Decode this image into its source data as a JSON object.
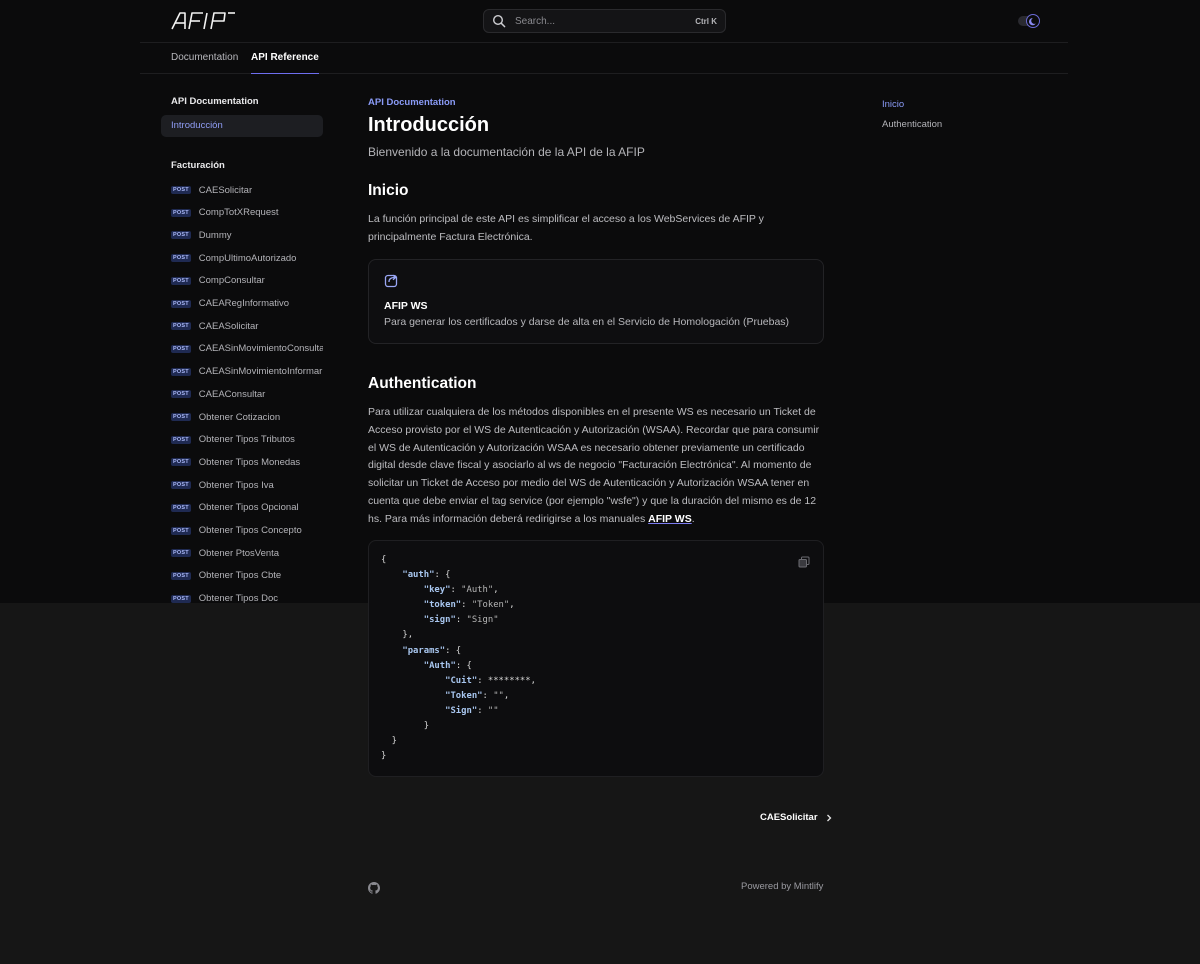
{
  "header": {
    "logo_text": "AFIP",
    "search_placeholder": "Search...",
    "search_shortcut": "Ctrl K"
  },
  "tabs": [
    {
      "label": "Documentation",
      "active": false
    },
    {
      "label": "API Reference",
      "active": true
    }
  ],
  "sidebar": {
    "group1_title": "API Documentation",
    "intro_label": "Introducción",
    "group2_title": "Facturación",
    "method_badge": "POST",
    "items": [
      "CAESolicitar",
      "CompTotXRequest",
      "Dummy",
      "CompUltimoAutorizado",
      "CompConsultar",
      "CAEARegInformativo",
      "CAEASolicitar",
      "CAEASinMovimientoConsultar",
      "CAEASinMovimientoInformar",
      "CAEAConsultar",
      "Obtener Cotizacion",
      "Obtener Tipos Tributos",
      "Obtener Tipos Monedas",
      "Obtener Tipos Iva",
      "Obtener Tipos Opcional",
      "Obtener Tipos Concepto",
      "Obtener PtosVenta",
      "Obtener Tipos Cbte",
      "Obtener Tipos Doc"
    ]
  },
  "main": {
    "eyebrow": "API Documentation",
    "title": "Introducción",
    "subtitle": "Bienvenido a la documentación de la API de la AFIP",
    "section1_title": "Inicio",
    "section1_body": "La función principal de este API es simplificar el acceso a los WebServices de AFIP y principalmente Factura Electrónica.",
    "card_title": "AFIP WS",
    "card_desc": "Para generar los certificados y darse de alta en el Servicio de Homologación (Pruebas)",
    "section2_title": "Authentication",
    "section2_body": "Para utilizar cualquiera de los métodos disponibles en el presente WS es necesario un Ticket de Acceso provisto por el WS de Autenticación y Autorización (WSAA). Recordar que para consumir el WS de Autenticación y Autorización WSAA es necesario obtener previamente un certificado digital desde clave fiscal y asociarlo al ws de negocio \"Facturación Electrónica\". Al momento de solicitar un Ticket de Acceso por medio del WS de Autenticación y Autorización WSAA tener en cuenta que debe enviar el tag service (por ejemplo \"wsfe\") y que la duración del mismo es de 12 hs. Para más información deberá redirigirse a los manuales ",
    "section2_link": "AFIP WS",
    "section2_end": ".",
    "code": "{\n    \"auth\": {\n        \"key\": \"Auth\",\n        \"token\": \"Token\",\n        \"sign\": \"Sign\"\n    },\n    \"params\": {\n        \"Auth\": {\n            \"Cuit\": ********,\n            \"Token\": \"\",\n            \"Sign\": \"\"\n        }\n  }\n}",
    "next_label": "CAESolicitar"
  },
  "toc": {
    "items": [
      {
        "label": "Inicio",
        "active": true
      },
      {
        "label": "Authentication",
        "active": false
      }
    ]
  },
  "footer": {
    "powered": "Powered by Mintlify"
  },
  "colors": {
    "accent": "#8a9bf7",
    "background": "#0b0b0c",
    "footer_background": "#161616"
  }
}
